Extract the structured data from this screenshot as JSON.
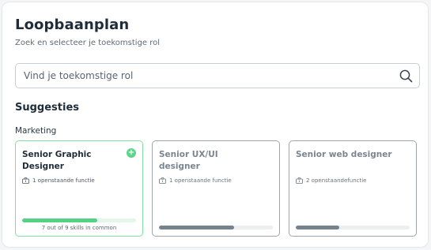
{
  "page": {
    "title": "Loopbaanplan",
    "subtitle": "Zoek en selecteer je toekomstige rol"
  },
  "search": {
    "placeholder": "Vind je toekomstige rol",
    "value": "",
    "icon": "search-icon"
  },
  "suggestions": {
    "heading": "Suggesties",
    "category": "Marketing",
    "cards": [
      {
        "title": "Senior Graphic Designer",
        "meta": "1 openstaande functie",
        "selected": true,
        "progress": 0.66,
        "skills_text": "7 out of 9 skills in common",
        "icon": "plus-circle-icon"
      },
      {
        "title": "Senior UX/UI designer",
        "meta": "1 openstaande functie",
        "selected": false,
        "progress": 0.66,
        "skills_text": ""
      },
      {
        "title": "Senior web designer",
        "meta": "2 openstaandefunctie",
        "selected": false,
        "progress": 0.38,
        "skills_text": ""
      }
    ]
  },
  "colors": {
    "accent_green": "#5fd48c",
    "muted_bar": "#76828c",
    "text_dark": "#1f2d3a"
  }
}
